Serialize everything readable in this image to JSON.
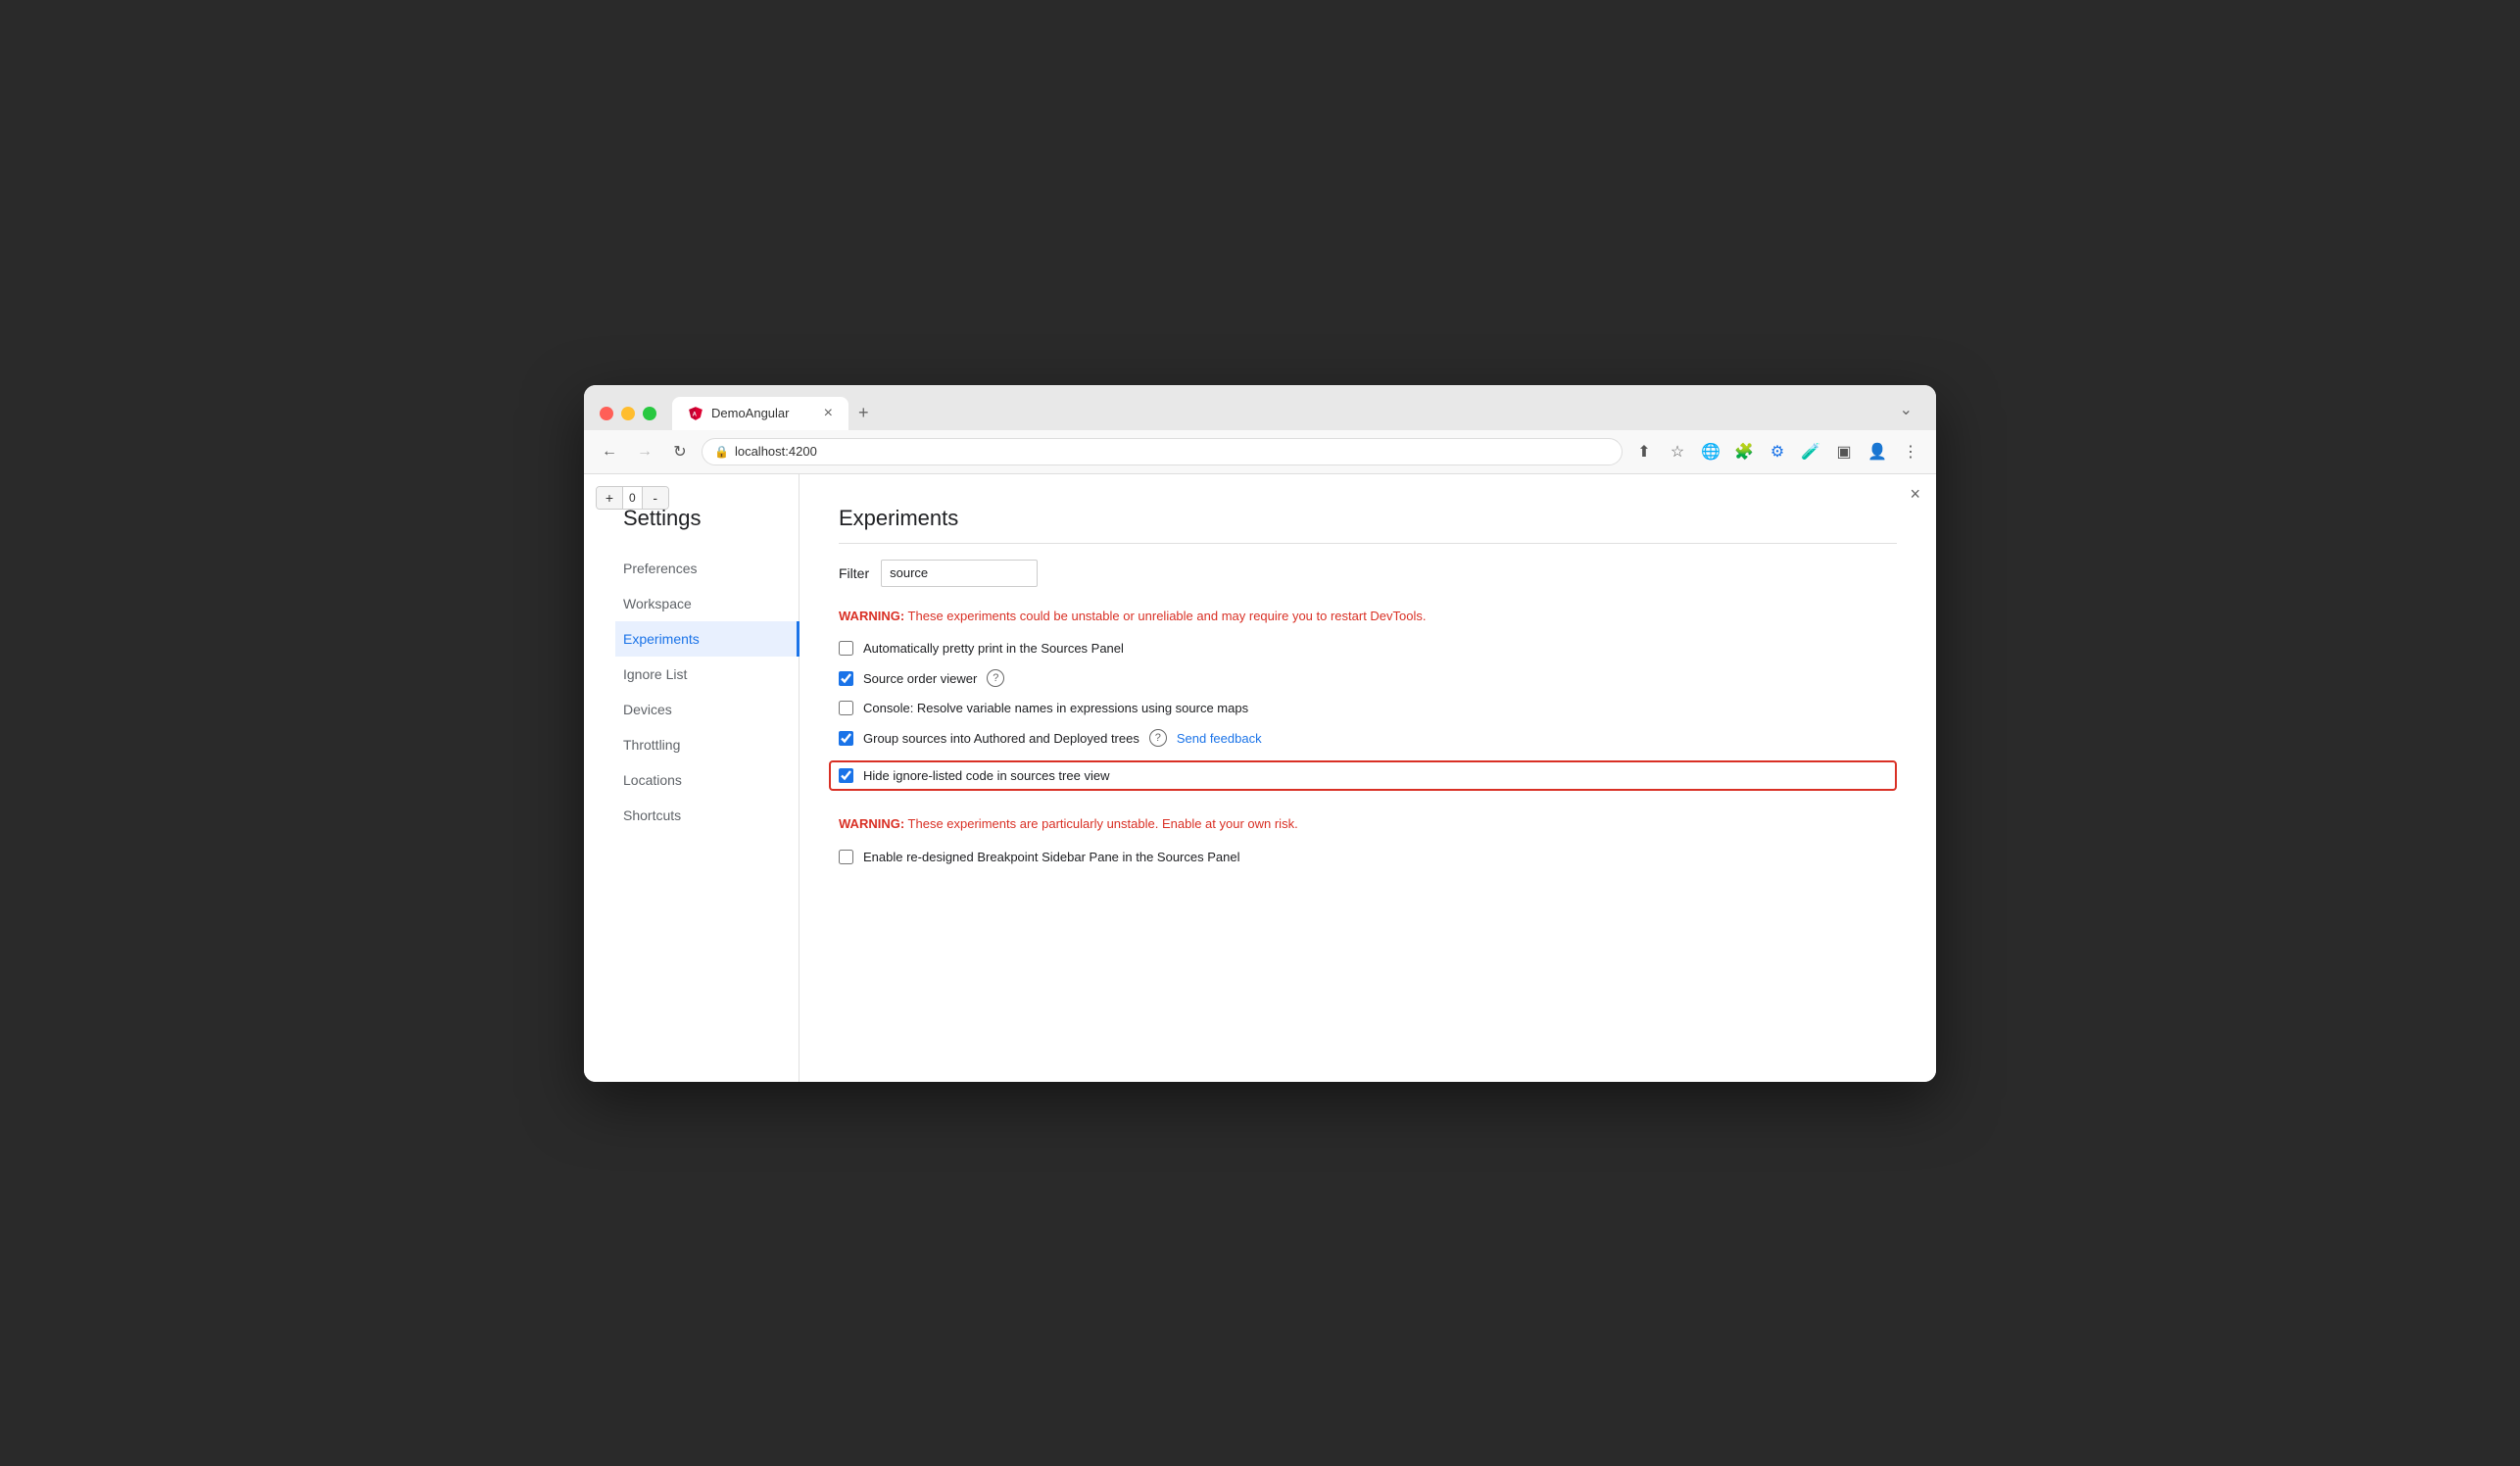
{
  "browser": {
    "tab_title": "DemoAngular",
    "tab_close_label": "×",
    "new_tab_label": "+",
    "address": "localhost:4200",
    "collapse_icon": "⌄"
  },
  "zoom": {
    "plus": "+",
    "value": "0",
    "minus": "-"
  },
  "close_button": "×",
  "sidebar": {
    "title": "Settings",
    "items": [
      {
        "id": "preferences",
        "label": "Preferences",
        "active": false
      },
      {
        "id": "workspace",
        "label": "Workspace",
        "active": false
      },
      {
        "id": "experiments",
        "label": "Experiments",
        "active": true
      },
      {
        "id": "ignore-list",
        "label": "Ignore List",
        "active": false
      },
      {
        "id": "devices",
        "label": "Devices",
        "active": false
      },
      {
        "id": "throttling",
        "label": "Throttling",
        "active": false
      },
      {
        "id": "locations",
        "label": "Locations",
        "active": false
      },
      {
        "id": "shortcuts",
        "label": "Shortcuts",
        "active": false
      }
    ]
  },
  "main": {
    "title": "Experiments",
    "filter_label": "Filter",
    "filter_value": "source",
    "filter_placeholder": "",
    "warning1": {
      "prefix": "WARNING:",
      "text": " These experiments could be unstable or unreliable and may require you to restart DevTools."
    },
    "experiments": [
      {
        "id": "pretty-print",
        "label": "Automatically pretty print in the Sources Panel",
        "checked": false,
        "highlighted": false,
        "has_help": false,
        "has_feedback": false
      },
      {
        "id": "source-order",
        "label": "Source order viewer",
        "checked": true,
        "highlighted": false,
        "has_help": true,
        "has_feedback": false
      },
      {
        "id": "console-resolve",
        "label": "Console: Resolve variable names in expressions using source maps",
        "checked": false,
        "highlighted": false,
        "has_help": false,
        "has_feedback": false
      },
      {
        "id": "group-sources",
        "label": "Group sources into Authored and Deployed trees",
        "checked": true,
        "highlighted": false,
        "has_help": true,
        "has_feedback": true,
        "feedback_label": "Send feedback"
      },
      {
        "id": "hide-ignore",
        "label": "Hide ignore-listed code in sources tree view",
        "checked": true,
        "highlighted": true,
        "has_help": false,
        "has_feedback": false
      }
    ],
    "warning2": {
      "prefix": "WARNING:",
      "text": " These experiments are particularly unstable. Enable at your own risk."
    },
    "unstable_experiments": [
      {
        "id": "breakpoint-sidebar",
        "label": "Enable re-designed Breakpoint Sidebar Pane in the Sources Panel",
        "checked": false,
        "highlighted": false
      }
    ]
  }
}
